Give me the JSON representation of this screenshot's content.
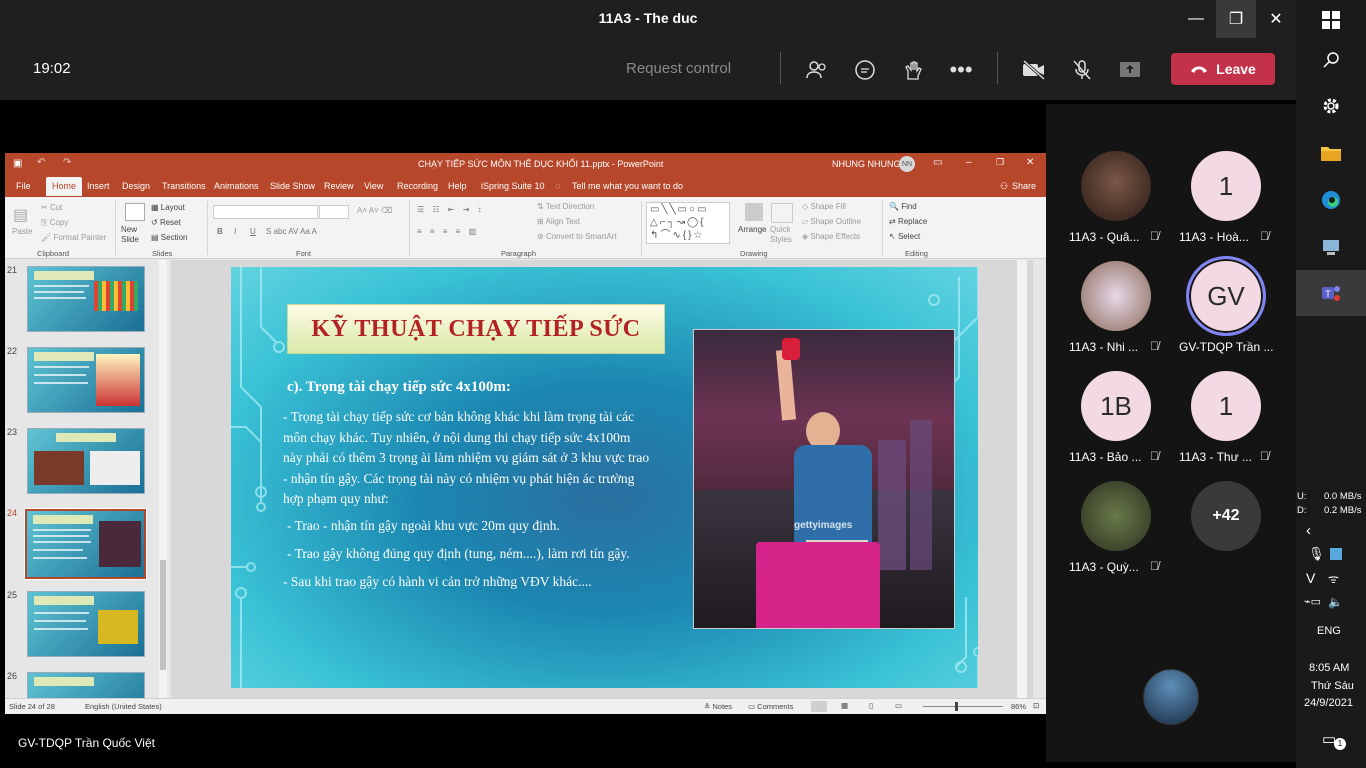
{
  "window": {
    "title": "11A3 - The duc",
    "minimize": "—",
    "maximize": "❐",
    "close": "✕"
  },
  "toolbar": {
    "time": "19:02",
    "request_control": "Request control",
    "leave": "Leave"
  },
  "presenter_caption": "GV-TDQP Trần Quốc Việt",
  "ppt": {
    "filename": "CHẠY TIẾP SỨC MÔN THỂ DỤC KHỐI 11.pptx - PowerPoint",
    "user": "NHUNG NHUNG",
    "user_initials": "NN",
    "tabs": [
      "File",
      "Home",
      "Insert",
      "Design",
      "Transitions",
      "Animations",
      "Slide Show",
      "Review",
      "View",
      "Recording",
      "Help",
      "iSpring Suite 10"
    ],
    "tell_me": "Tell me what you want to do",
    "share": "Share",
    "ribbon": {
      "paste": "Paste",
      "cut": "Cut",
      "copy": "Copy",
      "format_painter": "Format Painter",
      "clipboard": "Clipboard",
      "new_slide": "New Slide",
      "layout": "Layout",
      "reset": "Reset",
      "section": "Section",
      "slides": "Slides",
      "font": "Font",
      "paragraph": "Paragraph",
      "text_direction": "Text Direction",
      "align_text": "Align Text",
      "convert_smartart": "Convert to SmartArt",
      "arrange": "Arrange",
      "quick_styles": "Quick Styles",
      "shape_fill": "Shape Fill",
      "shape_outline": "Shape Outline",
      "shape_effects": "Shape Effects",
      "drawing": "Drawing",
      "find": "Find",
      "replace": "Replace",
      "select": "Select",
      "editing": "Editing"
    },
    "thumbs": [
      {
        "num": "21",
        "title": "KỸ THUẬT CHẠY TIẾP SỨC"
      },
      {
        "num": "22",
        "title": "KỸ THUẬT CHẠY TIẾP SỨC"
      },
      {
        "num": "23",
        "title": "KỸ THUẬT CHẠY VỀ ĐÍCH"
      },
      {
        "num": "24",
        "title": "KỸ THUẬT CHẠY TIẾP SỨC"
      },
      {
        "num": "25",
        "title": "KỸ THUẬT CHẠY TIẾP SỨC"
      },
      {
        "num": "26",
        "title": "KỸ THUẬT CHẠY TIẾP SỨC"
      }
    ],
    "slide": {
      "title": "KỸ THUẬT CHẠY TIẾP SỨC",
      "subtitle": "c). Trọng tài chạy tiếp sức 4x100m:",
      "para1": "- Trọng tài chạy tiếp sức cơ bản không khác khi làm trọng tài các môn chạy khác. Tuy nhiên, ở nội dung thi chạy tiếp sức 4x100m này phải có thêm 3 trọng ài làm nhiệm vụ giám sát ở 3 khu vực trao - nhận tín gậy. Các trọng tài này có nhiệm vụ phát hiện ác trường hợp phạm quy như:",
      "b1": "- Trao - nhận tín gậy ngoài khu vực 20m quy định.",
      "b2": "- Trao gậy không đúng quy định (tung, ném....), làm rơi tín gậy.",
      "b3": "- Sau khi trao gậy có hành vi cản trở những VĐV khác....",
      "photo_watermark": "gettyimages"
    },
    "status": {
      "slide_of": "Slide 24 of 28",
      "language": "English (United States)",
      "notes": "Notes",
      "comments": "Comments",
      "zoom": "86%"
    }
  },
  "participants": [
    {
      "name": "11A3 - Quâ...",
      "initial": "",
      "color": "#6b4a3a"
    },
    {
      "name": "11A3 - Hoà...",
      "initial": "1",
      "color": "#f3d9e3"
    },
    {
      "name": "11A3 - Nhi ...",
      "initial": "",
      "color": "#a08a80"
    },
    {
      "name": "GV-TDQP Trần ...",
      "initial": "GV",
      "color": "#f3d9e3"
    },
    {
      "name": "11A3 - Bảo ...",
      "initial": "1B",
      "color": "#f3d9e3"
    },
    {
      "name": "11A3 - Thư ...",
      "initial": "1",
      "color": "#f3d9e3"
    },
    {
      "name": "11A3 - Quỳ...",
      "initial": "",
      "color": "#3e4a2e"
    }
  ],
  "more_participants": "+42",
  "taskbar": {
    "net_up_label": "U:",
    "net_up": "0.0 MB/s",
    "net_down_label": "D:",
    "net_down": "0.2 MB/s",
    "lang": "ENG",
    "time": "8:05 AM",
    "day": "Thứ Sáu",
    "date": "24/9/2021",
    "notif_count": "1"
  }
}
